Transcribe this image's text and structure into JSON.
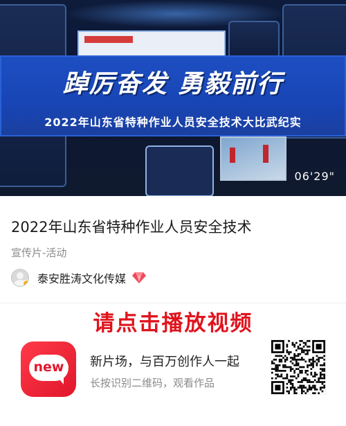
{
  "video": {
    "slogan": "踔厉奋发  勇毅前行",
    "subtitle": "2022年山东省特种作业人员安全技术大比武纪实",
    "duration": "06'29\""
  },
  "article": {
    "title": "2022年山东省特种作业人员安全技术",
    "tag": "宣传片-活动",
    "author": "泰安胜涛文化传媒"
  },
  "play_hint": "请点击播放视频",
  "promo": {
    "app_icon_text": "new",
    "main": "新片场，与百万创作人一起",
    "sub": "长按识别二维码，观看作品"
  },
  "colors": {
    "accent_red": "#e0141e",
    "banner_blue": "#1d4fc2",
    "diamond": "#f24a5a"
  },
  "icons": {
    "verified_badge": "yellow-dot-badge",
    "creator_level": "diamond-icon",
    "qr_code": "qr-code"
  }
}
